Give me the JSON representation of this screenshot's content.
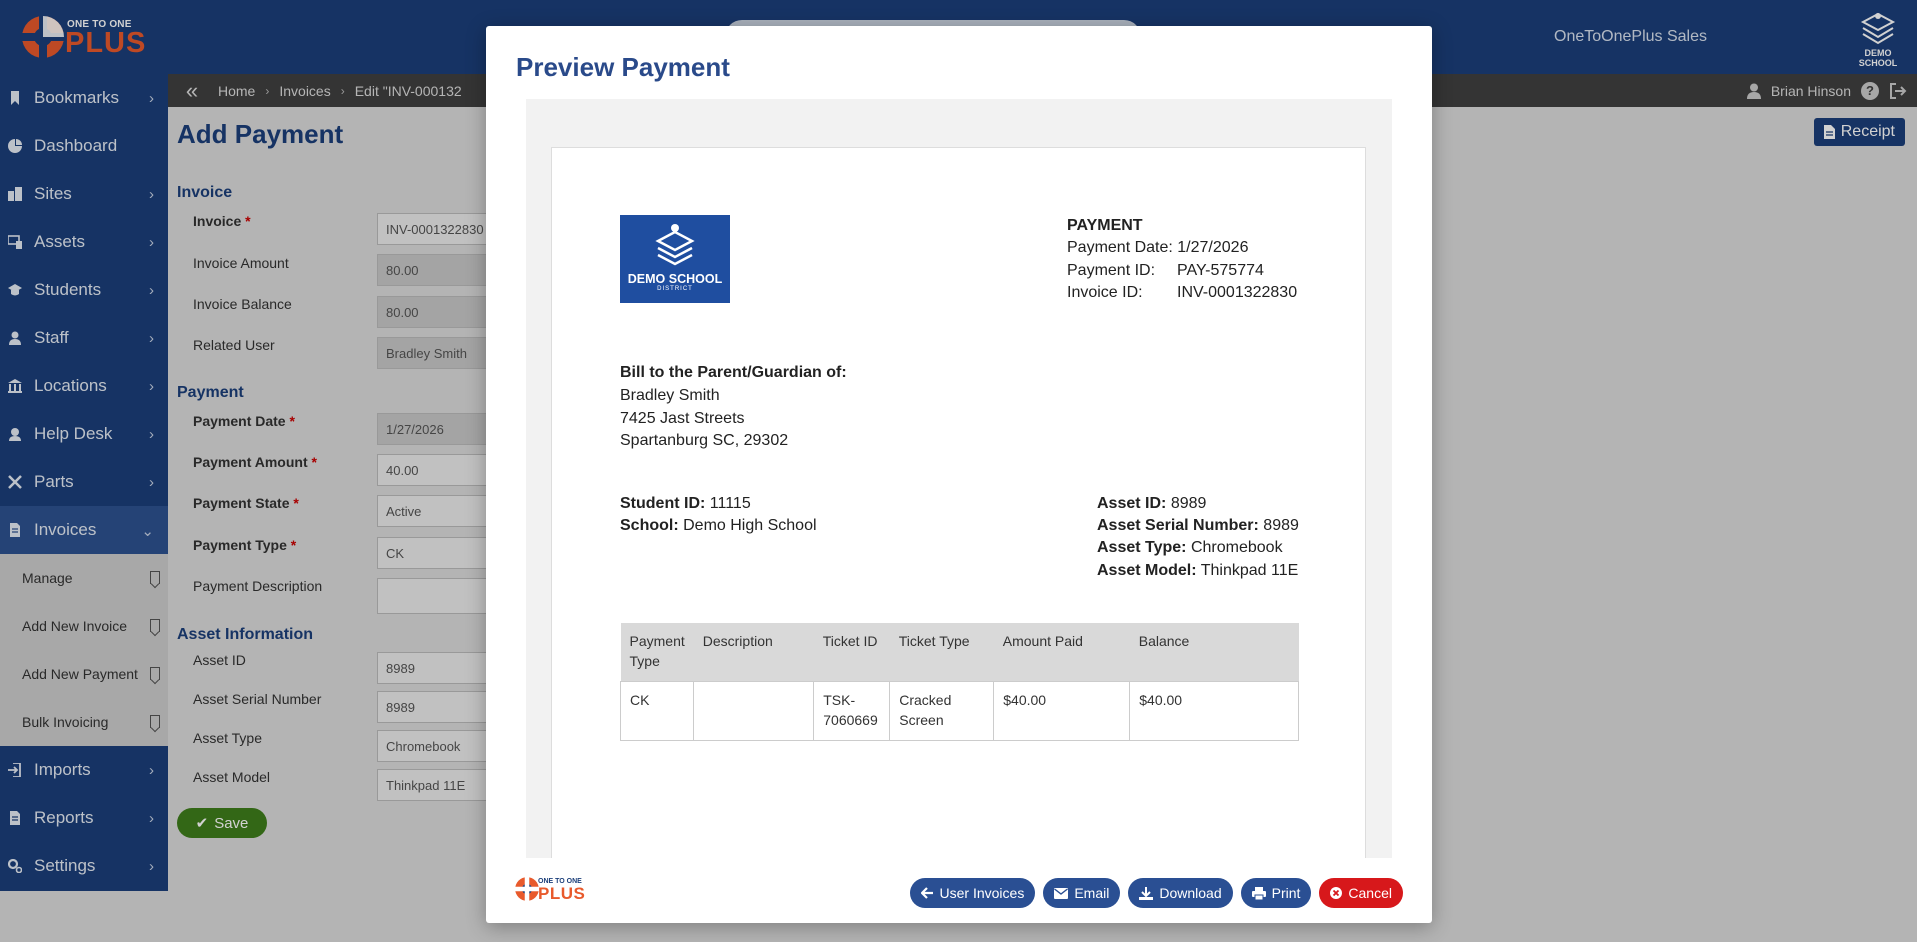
{
  "header": {
    "logo_small": "ONE TO ONE",
    "logo_big": "PLUS",
    "brand_name": "OneToOnePlus Sales",
    "district_logo_text": "DEMO SCHOOL",
    "user_name": "Brian Hinson"
  },
  "breadcrumb": [
    "Home",
    "Invoices",
    "Edit \"INV-000132"
  ],
  "sidebar": {
    "items": [
      {
        "label": "Bookmarks",
        "icon": "bookmark-icon",
        "chevron": true
      },
      {
        "label": "Dashboard",
        "icon": "dashboard-icon",
        "chevron": false
      },
      {
        "label": "Sites",
        "icon": "sites-icon",
        "chevron": true
      },
      {
        "label": "Assets",
        "icon": "devices-icon",
        "chevron": true
      },
      {
        "label": "Students",
        "icon": "graduation-cap-icon",
        "chevron": true
      },
      {
        "label": "Staff",
        "icon": "user-icon",
        "chevron": true
      },
      {
        "label": "Locations",
        "icon": "building-icon",
        "chevron": true
      },
      {
        "label": "Help Desk",
        "icon": "helpdesk-icon",
        "chevron": true
      },
      {
        "label": "Parts",
        "icon": "tools-icon",
        "chevron": true
      },
      {
        "label": "Invoices",
        "icon": "invoice-icon",
        "chevron": "down"
      }
    ],
    "sub_items": [
      "Manage",
      "Add New Invoice",
      "Add New Payment",
      "Bulk Invoicing"
    ],
    "items_after": [
      {
        "label": "Imports",
        "icon": "import-icon"
      },
      {
        "label": "Reports",
        "icon": "report-icon"
      },
      {
        "label": "Settings",
        "icon": "settings-icon"
      }
    ]
  },
  "form": {
    "title": "Add Payment",
    "receipt_label": "Receipt",
    "invoice_section": "Invoice",
    "invoice_label": "Invoice",
    "invoice_value": "INV-0001322830",
    "invoice_amount_label": "Invoice Amount",
    "invoice_amount_value": "80.00",
    "invoice_balance_label": "Invoice Balance",
    "invoice_balance_value": "80.00",
    "related_user_label": "Related User",
    "related_user_value": "Bradley Smith",
    "payment_section": "Payment",
    "payment_date_label": "Payment Date",
    "payment_date_value": "1/27/2026",
    "payment_amount_label": "Payment Amount",
    "payment_amount_value": "40.00",
    "payment_state_label": "Payment State",
    "payment_state_value": "Active",
    "payment_type_label": "Payment Type",
    "payment_type_value": "CK",
    "payment_description_label": "Payment Description",
    "payment_description_value": "",
    "asset_section": "Asset Information",
    "asset_id_label": "Asset ID",
    "asset_id_value": "8989",
    "asset_serial_label": "Asset Serial Number",
    "asset_serial_value": "8989",
    "asset_type_label": "Asset Type",
    "asset_type_value": "Chromebook",
    "asset_model_label": "Asset Model",
    "asset_model_value": "Thinkpad 11E",
    "save_label": "Save"
  },
  "modal": {
    "title": "Preview Payment",
    "receipt": {
      "logo_line1": "DEMO SCHOOL",
      "logo_line2": "DISTRICT",
      "heading": "PAYMENT",
      "payment_date_key": "Payment Date:",
      "payment_date": "1/27/2026",
      "payment_id_key": "Payment ID:",
      "payment_id": "PAY-575774",
      "invoice_id_key": "Invoice ID:",
      "invoice_id": "INV-0001322830",
      "bill_to_label": "Bill to the Parent/Guardian of:",
      "bill_name": "Bradley Smith",
      "bill_street": "7425 Jast Streets",
      "bill_city": "Spartanburg SC, 29302",
      "student_id_key": "Student ID:",
      "student_id": "11115",
      "school_key": "School:",
      "school": "Demo High School",
      "asset_id_key": "Asset ID:",
      "asset_id": "8989",
      "asset_serial_key": "Asset Serial Number:",
      "asset_serial": "8989",
      "asset_type_key": "Asset Type:",
      "asset_type": "Chromebook",
      "asset_model_key": "Asset Model:",
      "asset_model": "Thinkpad 11E",
      "table": {
        "headers": [
          "Payment Type",
          "Description",
          "Ticket ID",
          "Ticket Type",
          "Amount Paid",
          "Balance"
        ],
        "rows": [
          [
            "CK",
            "",
            "TSK-7060669",
            "Cracked Screen",
            "$40.00",
            "$40.00"
          ]
        ]
      }
    },
    "buttons": {
      "user_invoices": "User Invoices",
      "email": "Email",
      "download": "Download",
      "print": "Print",
      "cancel": "Cancel"
    },
    "footer_logo_small": "ONE TO ONE",
    "footer_logo_big": "PLUS"
  },
  "colors": {
    "nav_blue": "#1c3f7a",
    "title_blue": "#2a4a8a",
    "brand_orange": "#e85a2c",
    "save_green": "#3f7e1b",
    "cancel_red": "#d7181b"
  }
}
